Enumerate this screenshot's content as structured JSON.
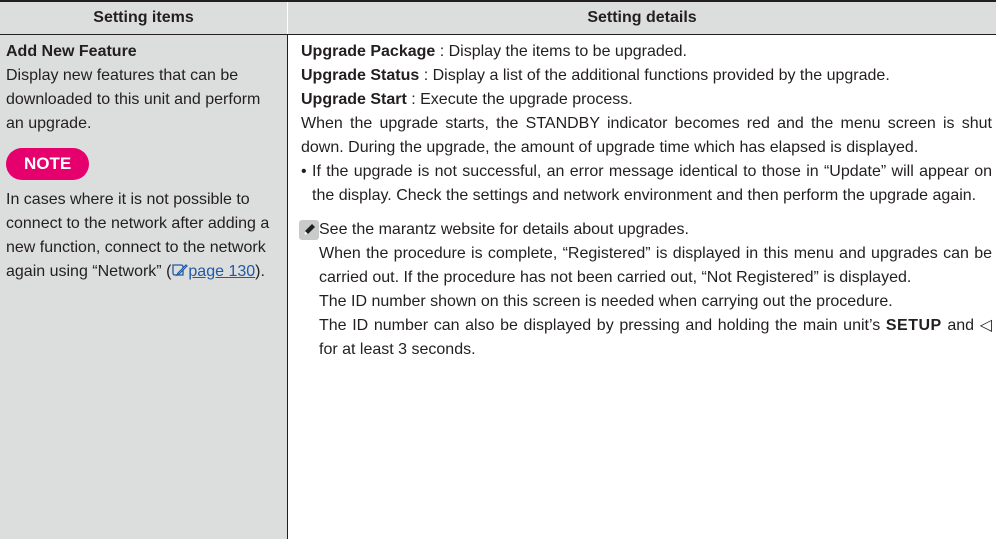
{
  "header": {
    "left": "Setting items",
    "right": "Setting details"
  },
  "left": {
    "title": "Add New Feature",
    "description": "Display new features that can be downloaded to this unit and perform an upgrade.",
    "note_label": "NOTE",
    "note_text_1": "In cases where it is not possible to connect to the network after adding a new function, connect to the network again using “Network” (",
    "note_link": "page 130",
    "note_text_2": ")."
  },
  "right": {
    "pkg_label": "Upgrade Package",
    "pkg_text": " : Display the items to be upgraded.",
    "status_label": "Upgrade Status",
    "status_text": " : Display a list of the additional functions provided by the upgrade.",
    "start_label": "Upgrade Start",
    "start_text": " : Execute the upgrade process.",
    "start_detail": "When the upgrade starts, the STANDBY indicator becomes red and the menu screen is shut down. During the upgrade, the amount of upgrade time which has elapsed is displayed.",
    "bullet": "If the upgrade is not successful, an error message identical to those in “Update” will appear on the display. Check the settings and network environment and then perform the upgrade again.",
    "memo_1": "See the marantz website for details about upgrades.",
    "memo_2": "When the procedure is complete, “Registered” is displayed in this menu and upgrades can be carried out. If the procedure has not been carried out, “Not Registered” is displayed.",
    "memo_3": "The ID number shown on this screen is needed when carrying out the procedure.",
    "memo_4a": "The ID number can also be displayed by pressing and holding the main unit’s ",
    "memo_4_setup": "SETUP",
    "memo_4b": " and ",
    "memo_4_arrow": "◁",
    "memo_4c": " for at least 3 seconds."
  },
  "colors": {
    "header_bg": "#dcdddd",
    "note_badge": "#e5006e",
    "link": "#1f5aa6"
  },
  "icons": [
    "pencil-icon",
    "page-reference-icon"
  ]
}
